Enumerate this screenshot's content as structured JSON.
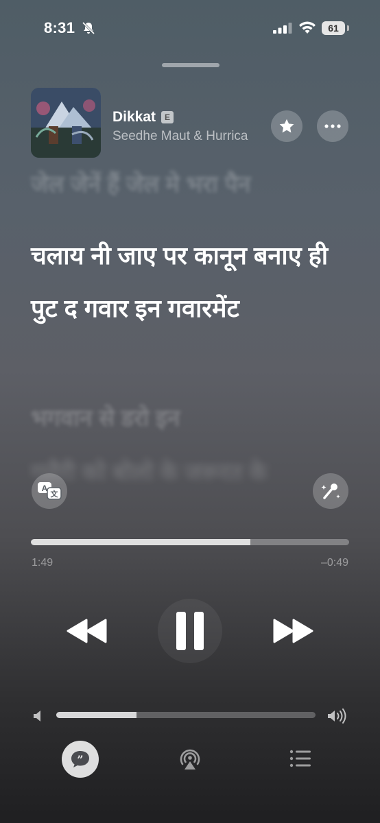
{
  "status_bar": {
    "time": "8:31",
    "battery": "61",
    "icons": [
      "bell-slash-icon",
      "cellular-signal-icon",
      "wifi-icon",
      "battery-icon"
    ]
  },
  "now_playing": {
    "title": "Dikkat",
    "explicit_badge": "E",
    "artist": "Seedhe Maut & Hurrica",
    "artwork_icon": "album-artwork"
  },
  "lyrics": {
    "previous": "जेल जेनें हैं जेल मे भरा पैन",
    "current": "चलाय नी जाए पर कानून बनाए ही पुट द गवार इन गवारमेंट",
    "next": "भगवान से डरो इन",
    "next_after": "गलैरी को बोलो के जरूरत के"
  },
  "playback": {
    "elapsed": "1:49",
    "remaining": "–0:49",
    "progress": 0.69
  },
  "volume": {
    "level": 0.31
  },
  "colors": {
    "accent": "#ffffff",
    "background_top": "#4f5d66",
    "background_bottom": "#1f1f21"
  }
}
